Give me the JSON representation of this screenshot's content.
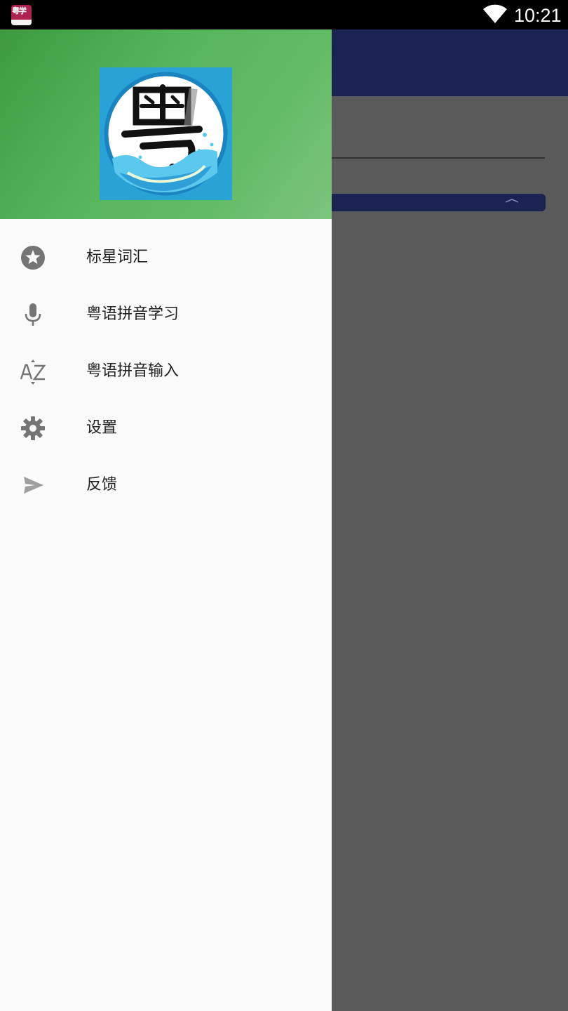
{
  "status_bar": {
    "time": "10:21",
    "notification_app_text": "粤学",
    "icons": [
      "app-notification-icon",
      "wifi-icon"
    ]
  },
  "drawer": {
    "header_logo_icon": "yue-character-logo",
    "header_color": "#4caf50",
    "items": [
      {
        "label": "标星词汇",
        "icon": "star-icon"
      },
      {
        "label": "粤语拼音学习",
        "icon": "microphone-icon"
      },
      {
        "label": "粤语拼音输入",
        "icon": "az-sort-icon"
      },
      {
        "label": "设置",
        "icon": "gear-icon"
      },
      {
        "label": "反馈",
        "icon": "send-icon"
      }
    ]
  },
  "background_app": {
    "toolbar_color": "#1a2352",
    "scrim_color": "#5a5a5a"
  }
}
